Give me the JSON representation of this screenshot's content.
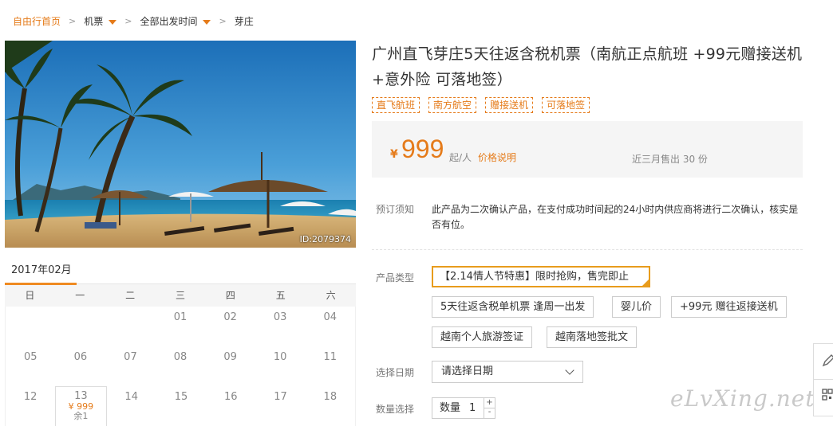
{
  "breadcrumb": {
    "home": "自由行首页",
    "item1": "机票",
    "item2": "全部出发时间",
    "current": "芽庄"
  },
  "hero": {
    "image_id": "ID:2079374"
  },
  "calendar": {
    "month": "2017年02月",
    "weekdays": [
      "日",
      "一",
      "二",
      "三",
      "四",
      "五",
      "六"
    ],
    "rows": [
      [
        "",
        "",
        "",
        "01",
        "02",
        "03",
        "04"
      ],
      [
        "05",
        "06",
        "07",
        "08",
        "09",
        "10",
        "11"
      ],
      [
        "12",
        "13",
        "14",
        "15",
        "16",
        "17",
        "18"
      ]
    ],
    "active_price": "¥ 999",
    "active_stock": "余1"
  },
  "product": {
    "title": "广州直飞芽庄5天往返含税机票（南航正点航班 +99元赠接送机+意外险 可落地签）",
    "tags": [
      "直飞航班",
      "南方航空",
      "赠接送机",
      "可落地签"
    ]
  },
  "price": {
    "currency": "¥",
    "amount": "999",
    "per": "起/人",
    "explain_link": "价格说明",
    "sold": "近三月售出 30 份"
  },
  "notice": {
    "label": "预订须知",
    "text": "此产品为二次确认产品，在支付成功时间起的24小时内供应商将进行二次确认，核实是否有位。"
  },
  "product_type": {
    "label": "产品类型",
    "options": [
      "【2.14情人节特惠】限时抢购，售完即止",
      "5天往返含税单机票 逢周一出发",
      "婴儿价",
      "+99元 赠往返接送机",
      "越南个人旅游签证",
      "越南落地签批文"
    ]
  },
  "date_select": {
    "label": "选择日期",
    "value": "请选择日期"
  },
  "quantity": {
    "label": "数量选择",
    "field_label": "数量",
    "value": "1",
    "plus": "+",
    "minus": "-"
  },
  "watermark": "eLvXing.net",
  "colors": {
    "accent": "#e57b1a",
    "selected_border": "#e89c1c",
    "price_bg": "#f5f5f5"
  }
}
